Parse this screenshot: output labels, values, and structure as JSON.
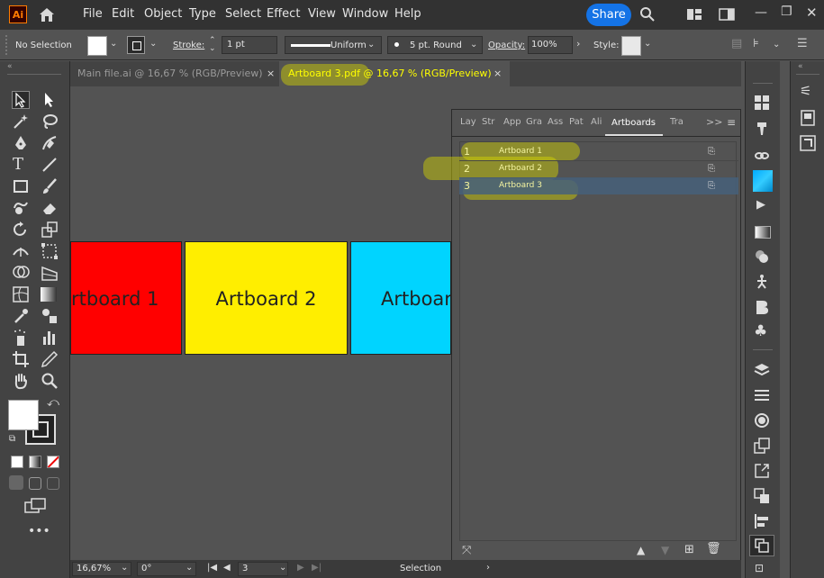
{
  "app": {
    "logo": "Ai"
  },
  "menu": [
    "File",
    "Edit",
    "Object",
    "Type",
    "Select",
    "Effect",
    "View",
    "Window",
    "Help"
  ],
  "share_label": "Share",
  "control": {
    "selection_label": "No Selection",
    "stroke_label": "Stroke:",
    "stroke_value": "1 pt",
    "profile_label": "Uniform",
    "brush_label": "5 pt. Round",
    "opacity_label": "Opacity:",
    "opacity_value": "100%",
    "style_label": "Style:"
  },
  "tabs": [
    {
      "label": "Main file.ai @ 16,67 % (RGB/Preview)",
      "close": "×",
      "active": false
    },
    {
      "label": "Artboard 3.pdf @ 16,67 % (RGB/Preview)",
      "close": "×",
      "active": true
    }
  ],
  "artboards_canvas": [
    {
      "label": "rtboard 1",
      "color": "#ff0000"
    },
    {
      "label": "Artboard 2",
      "color": "#ffee00"
    },
    {
      "label": "Artboard",
      "color": "#00d4ff"
    }
  ],
  "panel": {
    "tabs": [
      "Lay",
      "Str",
      "App",
      "Gra",
      "Ass",
      "Pat",
      "Ali",
      "Artboards",
      "Tra"
    ],
    "active_tab": "Artboards",
    "more": ">>",
    "rows": [
      {
        "num": "1",
        "name": "Artboard 1",
        "selected": false
      },
      {
        "num": "2",
        "name": "Artboard 2",
        "selected": false
      },
      {
        "num": "3",
        "name": "Artboard 3",
        "selected": true
      }
    ]
  },
  "status": {
    "zoom": "16,67%",
    "rotation": "0°",
    "artboard_num": "3",
    "tool": "Selection"
  },
  "colors": {
    "accent": "#1473e6",
    "highlight": "#d6d600",
    "selected_row": "#46607a"
  }
}
